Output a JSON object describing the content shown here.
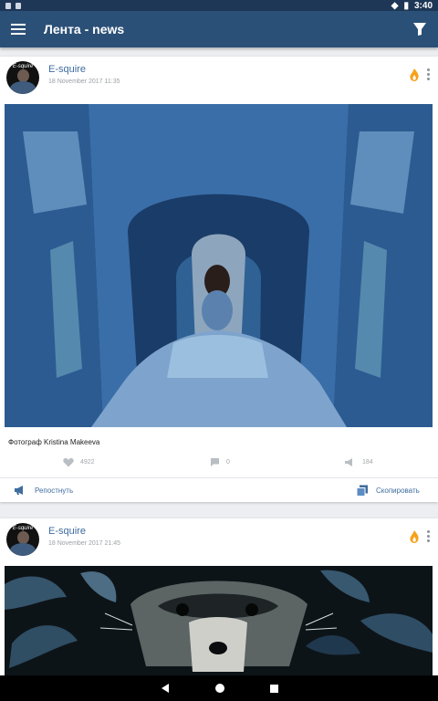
{
  "status_bar": {
    "time": "3:40"
  },
  "app_bar": {
    "title": "Лента - news"
  },
  "posts": [
    {
      "author": "E-squire",
      "avatar_text": "E-squire",
      "date": "18 November 2017  11:35",
      "caption": "Фотограф Kristina Makeeva",
      "likes": "4922",
      "comments": "0",
      "reposts": "184",
      "repost_label": "Репостнуть",
      "copy_label": "Скопировать"
    },
    {
      "author": "E-squire",
      "avatar_text": "E-squire",
      "date": "18 November 2017  21:45"
    }
  ],
  "colors": {
    "primary": "#2b5077",
    "accent": "#3f6d9e",
    "hot": "#f7a11b"
  },
  "icons": [
    "menu-icon",
    "filter-icon",
    "hot-icon",
    "more-icon",
    "heart-icon",
    "comment-icon",
    "repost-icon",
    "copy-icon",
    "back-icon",
    "home-icon",
    "recents-icon"
  ]
}
